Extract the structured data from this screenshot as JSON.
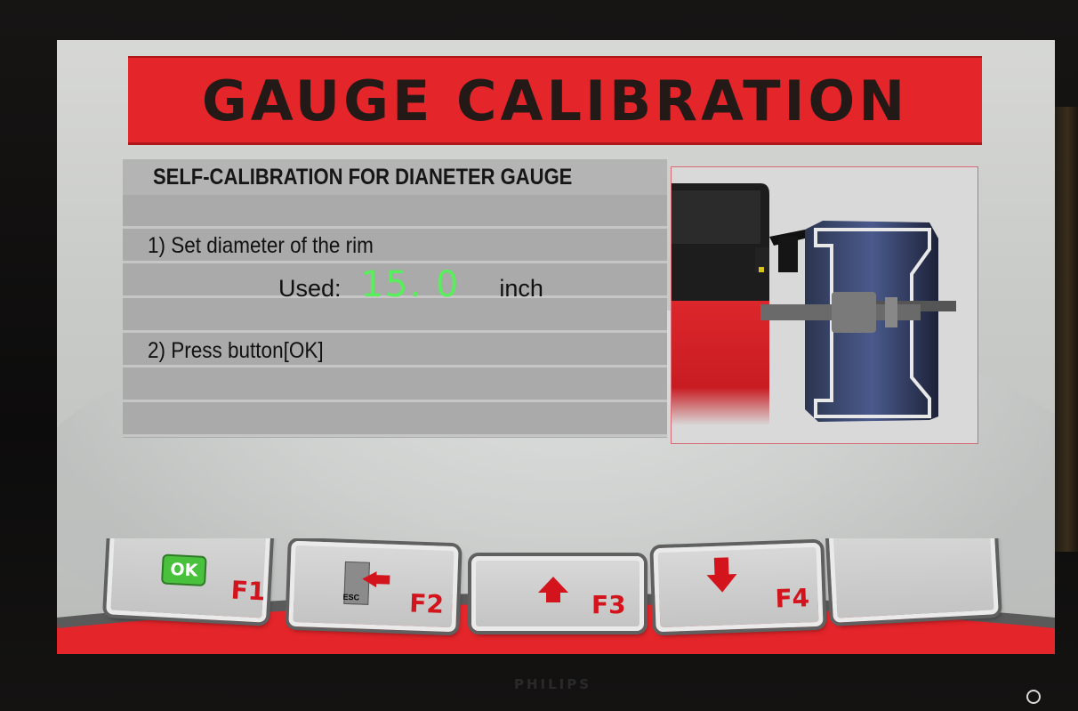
{
  "title": "GAUGE CALIBRATION",
  "panel": {
    "header": "SELF-CALIBRATION FOR DIANETER GAUGE",
    "step1": "1) Set diameter of the rim",
    "used_label": "Used:",
    "used_value": "15. 0",
    "used_unit": "inch",
    "step2": "2) Press button[OK]"
  },
  "function_keys": [
    {
      "key": "F1",
      "icon": "ok-icon",
      "icon_text": "OK"
    },
    {
      "key": "F2",
      "icon": "esc-exit-icon",
      "icon_text": "ESC"
    },
    {
      "key": "F3",
      "icon": "arrow-up-icon"
    },
    {
      "key": "F4",
      "icon": "arrow-down-icon"
    },
    {
      "key": "",
      "icon": ""
    }
  ],
  "monitor": {
    "brand": "PHILIPS"
  },
  "colors": {
    "accent_red": "#e4252a",
    "value_green": "#57ef5a",
    "ok_green": "#49c13c"
  }
}
